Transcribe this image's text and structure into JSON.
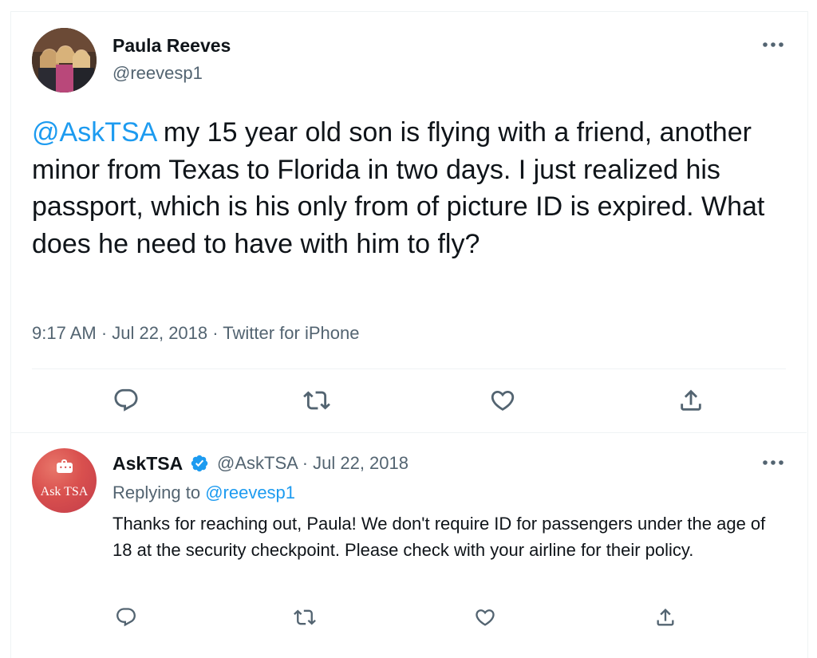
{
  "main_tweet": {
    "author_name": "Paula Reeves",
    "author_handle": "@reevesp1",
    "mention": "@AskTSA",
    "text": " my 15 year old son is flying with a friend, another minor from Texas to Florida in two days. I just realized his passport, which is his only from of picture ID is expired. What does he need to have with him to fly?",
    "meta": "9:17 AM · Jul 22, 2018 · Twitter for iPhone",
    "avatar_icon": "profile-photo",
    "more_icon": "more-horizontal-icon"
  },
  "reply_tweet": {
    "author_name": "AskTSA",
    "verified": true,
    "handle_date": "@AskTSA · Jul 22, 2018",
    "replying_prefix": "Replying to ",
    "replying_handle": "@reevesp1",
    "text": "Thanks for reaching out, Paula! We don't require ID for passengers under the age of 18 at the security checkpoint. Please check with your airline for their policy.",
    "avatar_label": "Ask TSA",
    "more_icon": "more-horizontal-icon"
  },
  "actions": [
    "reply-icon",
    "retweet-icon",
    "like-icon",
    "share-icon"
  ],
  "colors": {
    "link": "#1d9bf0",
    "text": "#0f1419",
    "secondary": "#536471",
    "divider": "#eff3f4",
    "tsa_avatar": "#d9504e"
  }
}
